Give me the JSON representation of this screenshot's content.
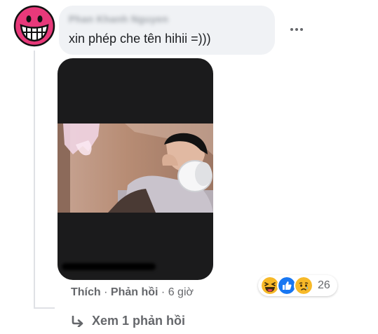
{
  "comment": {
    "author": "Phan Khanh Nguyen",
    "text": "xin phép che tên hihii =)))"
  },
  "avatar": {
    "icon": "grin-face-icon",
    "color": "#e8397a"
  },
  "actions": {
    "like_label": "Thích",
    "separator": "·",
    "reply_label": "Phản hồi",
    "timestamp": "6 giờ"
  },
  "reactions": {
    "icons": [
      "haha-reaction-icon",
      "like-reaction-icon",
      "sad-reaction-icon"
    ],
    "count": "26"
  },
  "replies": {
    "icon": "reply-arrow-icon",
    "label": "Xem 1 phản hồi"
  },
  "colors": {
    "bubble": "#f0f2f5",
    "secondary_text": "#65676b",
    "primary_text": "#1c1e21",
    "like_blue": "#1877f2"
  }
}
